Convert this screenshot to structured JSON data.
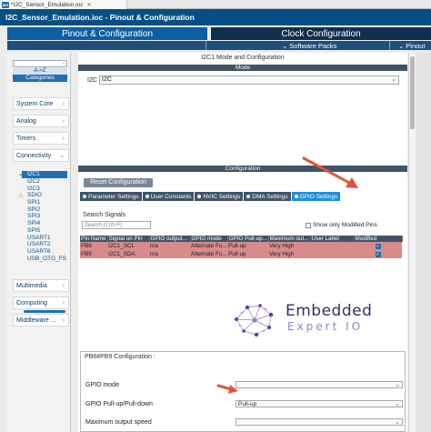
{
  "window": {
    "tab_title": "*I2C_Sensor_Emulation.ioc",
    "ide_icon_text": "MX",
    "editor_title": "I2C_Sensor_Emulation.ioc - Pinout & Configuration"
  },
  "topnav": {
    "pinout_tab": "Pinout & Configuration",
    "clock_tab": "Clock Configuration",
    "software_packs": "Software Packs",
    "pinout": "Pinout"
  },
  "sidebar": {
    "sort_label": "A->Z",
    "categories_label": "Categories",
    "sections": [
      {
        "label": "System Core"
      },
      {
        "label": "Analog"
      },
      {
        "label": "Timers"
      },
      {
        "label": "Connectivity"
      }
    ],
    "bottom_sections": [
      {
        "label": "Multimedia"
      },
      {
        "label": "Computing"
      },
      {
        "label": "Middleware ..."
      }
    ],
    "connectivity_items": [
      {
        "label": "I2C1",
        "state": "selected"
      },
      {
        "label": "I2C2",
        "state": ""
      },
      {
        "label": "I2C3",
        "state": ""
      },
      {
        "label": "SDIO",
        "state": "warning"
      },
      {
        "label": "SPI1",
        "state": ""
      },
      {
        "label": "SPI2",
        "state": ""
      },
      {
        "label": "SPI3",
        "state": ""
      },
      {
        "label": "SPI4",
        "state": ""
      },
      {
        "label": "SPI5",
        "state": ""
      },
      {
        "label": "USART1",
        "state": ""
      },
      {
        "label": "USART2",
        "state": ""
      },
      {
        "label": "USART6",
        "state": ""
      },
      {
        "label": "USB_OTG_FS",
        "state": ""
      }
    ]
  },
  "main": {
    "panel_title": "I2C1 Mode and Configuration",
    "mode_section": "Mode",
    "mode_label": "I2C",
    "mode_value": "I2C",
    "config_section": "Configuration",
    "reset_button": "Reset Configuration",
    "config_tabs": [
      {
        "label": "Parameter Settings",
        "active": false
      },
      {
        "label": "User Constants",
        "active": false
      },
      {
        "label": "NVIC Settings",
        "active": false
      },
      {
        "label": "DMA Settings",
        "active": false
      },
      {
        "label": "GPIO Settings",
        "active": true
      }
    ],
    "search_signals_label": "Search Signals",
    "search_placeholder": "Search (Crtl+F)",
    "show_modified_label": "Show only Modified Pins",
    "table": {
      "headers": [
        "Pin Name",
        "Signal on Pin",
        "GPIO output...",
        "GPIO mode",
        "GPIO Pull-up...",
        "Maximum out...",
        "User Label",
        "Modified"
      ],
      "rows": [
        [
          "PB6",
          "I2C1_SCL",
          "n/a",
          "Alternate Fu...",
          "Pull-up",
          "Very High",
          "",
          "checked"
        ],
        [
          "PB9",
          "I2C1_SDA",
          "n/a",
          "Alternate Fu...",
          "Pull-up",
          "Very High",
          "",
          "checked"
        ]
      ]
    },
    "logo": {
      "line1": "Embedded",
      "line2": "Expert IO"
    },
    "pin_group_title": "PB6#PB9 Configuration :",
    "params": [
      {
        "label": "GPIO mode",
        "value": ""
      },
      {
        "label": "GPIO Pull-up/Pull-down",
        "value": "Pull-up"
      },
      {
        "label": "Maximum output speed",
        "value": ""
      }
    ]
  },
  "colors": {
    "title_bar": "#054f84",
    "tab_active": "#0b5fa5",
    "tab_inactive": "#0f2f4f",
    "section_bar": "#3f5467",
    "highlight_row": "#d98b8b",
    "annotation_arrow": "#e2543a",
    "logo_text": "#3b2a6b"
  }
}
